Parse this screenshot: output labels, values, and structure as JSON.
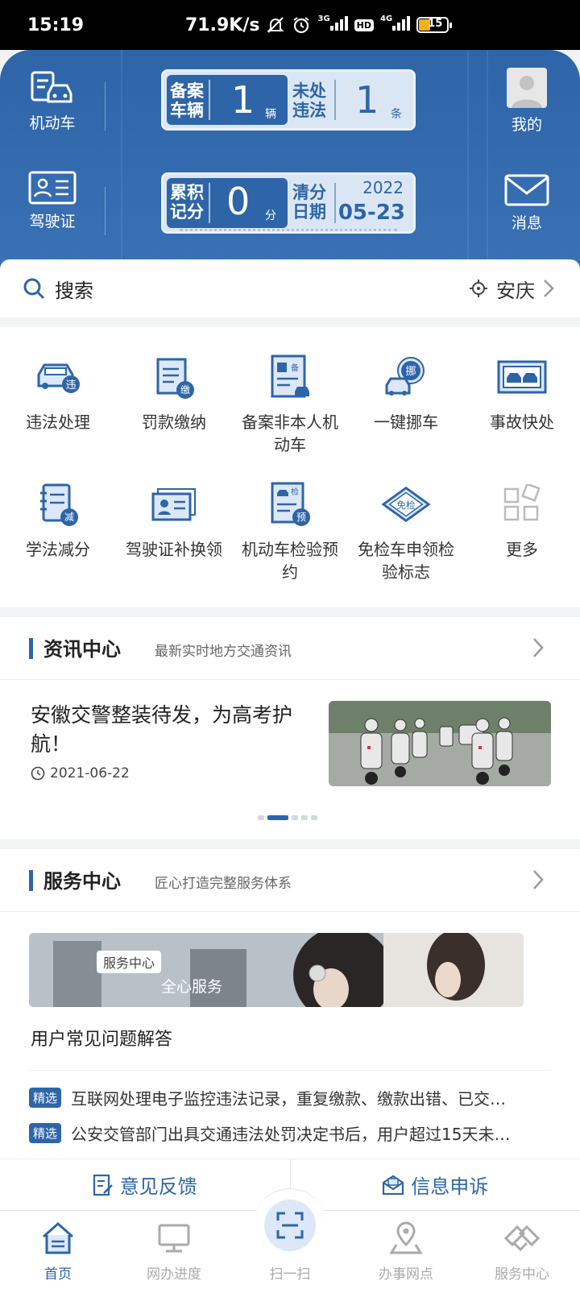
{
  "status_bar": {
    "time": "15:19",
    "speed": "71.9K/s",
    "net1": "3G",
    "net2": "4G",
    "hd": "HD",
    "battery": "15"
  },
  "header": {
    "left_top_label": "机动车",
    "left_bottom_label": "驾驶证",
    "right_top_label": "我的",
    "right_bottom_label": "消息",
    "vehicles": {
      "label_a_line1": "备案",
      "label_a_line2": "车辆",
      "count": "1",
      "count_unit": "辆",
      "label_b_line1": "未处",
      "label_b_line2": "违法",
      "violations": "1",
      "violations_unit": "条"
    },
    "license": {
      "label_a_line1": "累积",
      "label_a_line2": "记分",
      "points": "0",
      "points_unit": "分",
      "label_b_line1": "清分",
      "label_b_line2": "日期",
      "clear_year": "2022",
      "clear_date": "05-23"
    }
  },
  "search": {
    "placeholder": "搜索",
    "city": "安庆"
  },
  "services_grid": [
    {
      "label": "违法处理",
      "icon": "car-violation-icon"
    },
    {
      "label": "罚款缴纳",
      "icon": "fine-payment-icon"
    },
    {
      "label": "备案非本人机动车",
      "icon": "register-vehicle-icon"
    },
    {
      "label": "一键挪车",
      "icon": "move-car-icon"
    },
    {
      "label": "事故快处",
      "icon": "accident-icon"
    },
    {
      "label": "学法减分",
      "icon": "study-deduct-icon"
    },
    {
      "label": "驾驶证补换领",
      "icon": "license-replace-icon"
    },
    {
      "label": "机动车检验预约",
      "icon": "inspection-appointment-icon"
    },
    {
      "label": "免检车申领检验标志",
      "icon": "exempt-sticker-icon"
    },
    {
      "label": "更多",
      "icon": "more-grid-icon"
    }
  ],
  "news": {
    "title": "资讯中心",
    "subtitle": "最新实时地方交通资讯",
    "headline": "安徽交警整装待发，为高考护航！",
    "date": "2021-06-22"
  },
  "service_center": {
    "title": "服务中心",
    "subtitle": "匠心打造完整服务体系",
    "banner_tag": "服务中心",
    "banner_slogan": "全心服务",
    "faq_title": "用户常见问题解答",
    "faq": [
      {
        "badge": "精选",
        "text": "互联网处理电子监控违法记录，重复缴款、缴款出错、已交…"
      },
      {
        "badge": "精选",
        "text": "公安交管部门出具交通违法处罚决定书后，用户超过15天未…"
      }
    ],
    "feedback": "意见反馈",
    "appeal": "信息申诉"
  },
  "tabs": [
    {
      "label": "首页",
      "active": true
    },
    {
      "label": "网办进度",
      "active": false
    },
    {
      "label": "扫一扫",
      "active": false
    },
    {
      "label": "办事网点",
      "active": false
    },
    {
      "label": "服务中心",
      "active": false
    }
  ],
  "colors": {
    "brand": "#2e65a8",
    "light": "#dbe6f5"
  }
}
